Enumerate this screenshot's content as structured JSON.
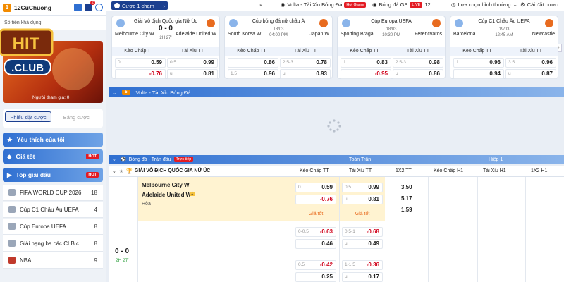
{
  "user": {
    "level": "1",
    "name": "12CuChuong",
    "notif_count": "2",
    "balance_text": "Số tiền khả dụng"
  },
  "banner": {
    "join_text": "Người tham gia: 0"
  },
  "pick_tabs": {
    "on": "Phiếu đặt cược",
    "off": "Bảng cược"
  },
  "sidebar": {
    "favorites": "Yêu thích của tôi",
    "best": "Giá tốt",
    "hot": "HOT",
    "top_leagues": "Top giải đấu",
    "leagues": [
      {
        "name": "FIFA WORLD CUP 2026",
        "count": "18"
      },
      {
        "name": "Cúp C1 Châu Âu UEFA",
        "count": "4"
      },
      {
        "name": "Cúp Europa UEFA",
        "count": "8"
      },
      {
        "name": "Giải hạng ba các CLB c...",
        "count": "8"
      },
      {
        "name": "NBA",
        "count": "9"
      }
    ]
  },
  "topbar": {
    "bet_mode": "Cược 1 chạm",
    "volta": "Volta - Tài Xỉu Bóng Đá",
    "hot_game": "Hot Game",
    "bongda_gs": "Bóng đá GS",
    "live": "LIVE",
    "live_count": "12",
    "sort": "Lựa chọn bình thường",
    "settings": "Cài đặt cược"
  },
  "cards": [
    {
      "league": "Giải Vô địch Quốc gia Nữ Úc",
      "home": "Melbourne City W",
      "away": "Adelaide United W",
      "score": "0 - 0",
      "time": "2H 27'",
      "h1": "Kèo Chấp TT",
      "h2": "Tài Xỉu TT",
      "r1": [
        "0",
        "0.59",
        "0.5",
        "0.99"
      ],
      "r2": [
        "",
        "-0.76",
        "u",
        "0.81"
      ],
      "red": [
        false,
        true,
        false,
        false
      ]
    },
    {
      "league": "Cúp bóng đá nữ châu Á",
      "home": "South Korea W",
      "away": "Japan W",
      "date": "18/03",
      "time": "04:00 PM",
      "h1": "Kèo Chấp TT",
      "h2": "Tài Xỉu TT",
      "r1": [
        "",
        "0.86",
        "2.5-3",
        "0.78"
      ],
      "r2": [
        "1.5",
        "0.96",
        "u",
        "0.93"
      ],
      "red": [
        false,
        false,
        false,
        false
      ]
    },
    {
      "league": "Cúp Europa UEFA",
      "home": "Sporting Braga",
      "away": "Ferencvaros",
      "date": "18/03",
      "time": "10:30 PM",
      "h1": "Kèo Chấp TT",
      "h2": "Tài Xỉu TT",
      "r1": [
        "1",
        "0.83",
        "2.5-3",
        "0.98"
      ],
      "r2": [
        "",
        "-0.95",
        "u",
        "0.86"
      ],
      "red": [
        false,
        true,
        false,
        false
      ]
    },
    {
      "league": "Cúp C1 Châu Âu UEFA",
      "home": "Barcelona",
      "away": "Newcastle",
      "date": "19/03",
      "time": "12:45 AM",
      "h1": "Kèo Chấp TT",
      "h2": "Tài Xỉu TT",
      "r1": [
        "1",
        "0.96",
        "3.5",
        "0.96"
      ],
      "r2": [
        "",
        "0.94",
        "u",
        "0.87"
      ],
      "red": [
        false,
        false,
        false,
        false
      ]
    }
  ],
  "volta_bar": {
    "badge": "5",
    "title": "Volta - Tài Xỉu Bóng Đá"
  },
  "table": {
    "section": "Bóng đá - Trận đấu",
    "live_tag": "Trực tiếp",
    "full": "Toàn Trận",
    "half": "Hiệp 1",
    "league": "GIẢI VÔ ĐỊCH QUỐC GIA NỮ ÚC",
    "cols": [
      "Kèo Chấp TT",
      "Tài Xỉu TT",
      "1X2 TT",
      "Kèo Chấp H1",
      "Tài Xỉu H1",
      "1X2 H1"
    ],
    "home": "Melbourne City W",
    "away": "Adelaide United W",
    "card": "1",
    "draw": "Hòa",
    "score": "0 - 0",
    "time": "2H 27'",
    "best": "Giá tốt",
    "rows": [
      {
        "hl": "0",
        "hv": "0.59",
        "tl": "0.5",
        "tv": "0.99",
        "hv2": "-0.76",
        "tl2": "u",
        "tv2": "0.81"
      },
      {
        "hl": "0-0.5",
        "hv": "-0.63",
        "tl": "0.5-1",
        "tv": "-0.68",
        "hv2": "0.46",
        "tl2": "u",
        "tv2": "0.49"
      },
      {
        "hl": "0.5",
        "hv": "-0.42",
        "tl": "1-1.5",
        "tv": "-0.36",
        "hv2": "0.25",
        "tl2": "u",
        "tv2": "0.17"
      }
    ],
    "x12": [
      "3.50",
      "5.17",
      "1.59"
    ]
  }
}
